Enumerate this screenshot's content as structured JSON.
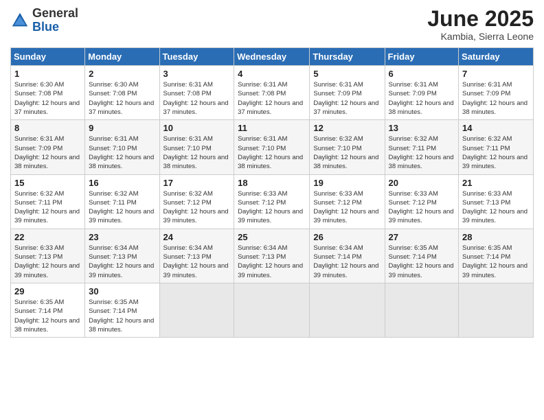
{
  "header": {
    "logo_general": "General",
    "logo_blue": "Blue",
    "month_title": "June 2025",
    "location": "Kambia, Sierra Leone"
  },
  "weekdays": [
    "Sunday",
    "Monday",
    "Tuesday",
    "Wednesday",
    "Thursday",
    "Friday",
    "Saturday"
  ],
  "weeks": [
    [
      {
        "day": "1",
        "sunrise": "6:30 AM",
        "sunset": "7:08 PM",
        "daylight": "12 hours and 37 minutes."
      },
      {
        "day": "2",
        "sunrise": "6:30 AM",
        "sunset": "7:08 PM",
        "daylight": "12 hours and 37 minutes."
      },
      {
        "day": "3",
        "sunrise": "6:31 AM",
        "sunset": "7:08 PM",
        "daylight": "12 hours and 37 minutes."
      },
      {
        "day": "4",
        "sunrise": "6:31 AM",
        "sunset": "7:08 PM",
        "daylight": "12 hours and 37 minutes."
      },
      {
        "day": "5",
        "sunrise": "6:31 AM",
        "sunset": "7:09 PM",
        "daylight": "12 hours and 37 minutes."
      },
      {
        "day": "6",
        "sunrise": "6:31 AM",
        "sunset": "7:09 PM",
        "daylight": "12 hours and 38 minutes."
      },
      {
        "day": "7",
        "sunrise": "6:31 AM",
        "sunset": "7:09 PM",
        "daylight": "12 hours and 38 minutes."
      }
    ],
    [
      {
        "day": "8",
        "sunrise": "6:31 AM",
        "sunset": "7:09 PM",
        "daylight": "12 hours and 38 minutes."
      },
      {
        "day": "9",
        "sunrise": "6:31 AM",
        "sunset": "7:10 PM",
        "daylight": "12 hours and 38 minutes."
      },
      {
        "day": "10",
        "sunrise": "6:31 AM",
        "sunset": "7:10 PM",
        "daylight": "12 hours and 38 minutes."
      },
      {
        "day": "11",
        "sunrise": "6:31 AM",
        "sunset": "7:10 PM",
        "daylight": "12 hours and 38 minutes."
      },
      {
        "day": "12",
        "sunrise": "6:32 AM",
        "sunset": "7:10 PM",
        "daylight": "12 hours and 38 minutes."
      },
      {
        "day": "13",
        "sunrise": "6:32 AM",
        "sunset": "7:11 PM",
        "daylight": "12 hours and 38 minutes."
      },
      {
        "day": "14",
        "sunrise": "6:32 AM",
        "sunset": "7:11 PM",
        "daylight": "12 hours and 39 minutes."
      }
    ],
    [
      {
        "day": "15",
        "sunrise": "6:32 AM",
        "sunset": "7:11 PM",
        "daylight": "12 hours and 39 minutes."
      },
      {
        "day": "16",
        "sunrise": "6:32 AM",
        "sunset": "7:11 PM",
        "daylight": "12 hours and 39 minutes."
      },
      {
        "day": "17",
        "sunrise": "6:32 AM",
        "sunset": "7:12 PM",
        "daylight": "12 hours and 39 minutes."
      },
      {
        "day": "18",
        "sunrise": "6:33 AM",
        "sunset": "7:12 PM",
        "daylight": "12 hours and 39 minutes."
      },
      {
        "day": "19",
        "sunrise": "6:33 AM",
        "sunset": "7:12 PM",
        "daylight": "12 hours and 39 minutes."
      },
      {
        "day": "20",
        "sunrise": "6:33 AM",
        "sunset": "7:12 PM",
        "daylight": "12 hours and 39 minutes."
      },
      {
        "day": "21",
        "sunrise": "6:33 AM",
        "sunset": "7:13 PM",
        "daylight": "12 hours and 39 minutes."
      }
    ],
    [
      {
        "day": "22",
        "sunrise": "6:33 AM",
        "sunset": "7:13 PM",
        "daylight": "12 hours and 39 minutes."
      },
      {
        "day": "23",
        "sunrise": "6:34 AM",
        "sunset": "7:13 PM",
        "daylight": "12 hours and 39 minutes."
      },
      {
        "day": "24",
        "sunrise": "6:34 AM",
        "sunset": "7:13 PM",
        "daylight": "12 hours and 39 minutes."
      },
      {
        "day": "25",
        "sunrise": "6:34 AM",
        "sunset": "7:13 PM",
        "daylight": "12 hours and 39 minutes."
      },
      {
        "day": "26",
        "sunrise": "6:34 AM",
        "sunset": "7:14 PM",
        "daylight": "12 hours and 39 minutes."
      },
      {
        "day": "27",
        "sunrise": "6:35 AM",
        "sunset": "7:14 PM",
        "daylight": "12 hours and 39 minutes."
      },
      {
        "day": "28",
        "sunrise": "6:35 AM",
        "sunset": "7:14 PM",
        "daylight": "12 hours and 39 minutes."
      }
    ],
    [
      {
        "day": "29",
        "sunrise": "6:35 AM",
        "sunset": "7:14 PM",
        "daylight": "12 hours and 38 minutes."
      },
      {
        "day": "30",
        "sunrise": "6:35 AM",
        "sunset": "7:14 PM",
        "daylight": "12 hours and 38 minutes."
      },
      null,
      null,
      null,
      null,
      null
    ]
  ]
}
